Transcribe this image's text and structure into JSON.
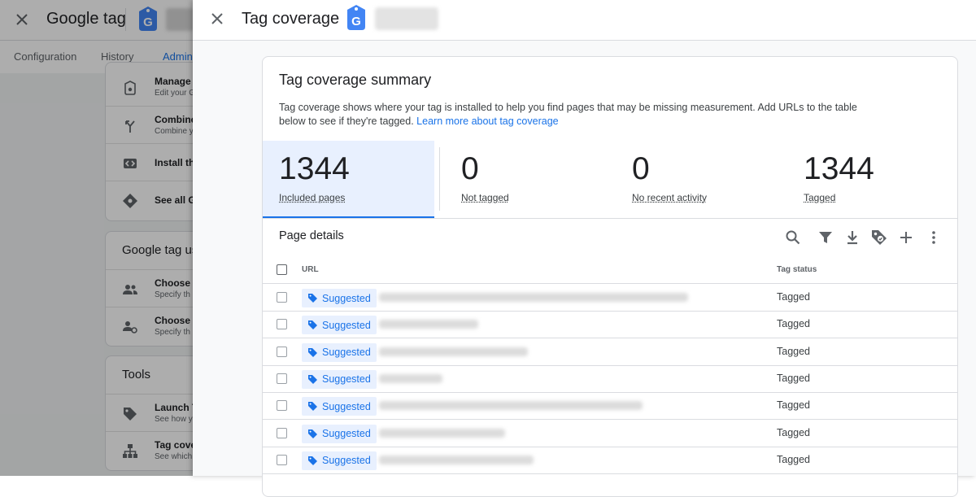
{
  "background": {
    "app_title": "Google tag",
    "tabs": [
      "Configuration",
      "History",
      "Admin"
    ],
    "cards": [
      {
        "title": "",
        "rows": [
          {
            "icon": "tag-settings-icon",
            "line1": "Manage",
            "line2": "Edit your G"
          },
          {
            "icon": "merge-icon",
            "line1": "Combine",
            "line2": "Combine y"
          },
          {
            "icon": "code-icon",
            "line1": "Install th",
            "line2": ""
          },
          {
            "icon": "diamond-icon",
            "line1": "See all G",
            "line2": ""
          }
        ]
      },
      {
        "title": "Google tag use",
        "rows": [
          {
            "icon": "people-icon",
            "line1": "Choose w",
            "line2": "Specify th"
          },
          {
            "icon": "people-settings-icon",
            "line1": "Choose w",
            "line2": "Specify th"
          }
        ]
      },
      {
        "title": "Tools",
        "rows": [
          {
            "icon": "tag-launch-icon",
            "line1": "Launch T",
            "line2": "See how y"
          },
          {
            "icon": "sitemap-icon",
            "line1": "Tag cove",
            "line2": "See which"
          }
        ]
      }
    ]
  },
  "panel": {
    "title": "Tag coverage",
    "summary": {
      "title": "Tag coverage summary",
      "description": "Tag coverage shows where your tag is installed to help you find pages that may be missing measurement. Add URLs to the table below to see if they're tagged.",
      "link": "Learn more about tag coverage"
    },
    "stats": [
      {
        "value": "1344",
        "label": "Included pages"
      },
      {
        "value": "0",
        "label": "Not tagged"
      },
      {
        "value": "0",
        "label": "No recent activity"
      },
      {
        "value": "1344",
        "label": "Tagged"
      }
    ],
    "details": {
      "title": "Page details",
      "toolbar": [
        "search-icon",
        "filter-icon",
        "download-icon",
        "tag-icon",
        "add-icon",
        "more-vert-icon"
      ],
      "columns": {
        "url": "URL",
        "status": "Tag status"
      },
      "rows": [
        {
          "chip": "Suggested",
          "status": "Tagged"
        },
        {
          "chip": "Suggested",
          "status": "Tagged"
        },
        {
          "chip": "Suggested",
          "status": "Tagged"
        },
        {
          "chip": "Suggested",
          "status": "Tagged"
        },
        {
          "chip": "Suggested",
          "status": "Tagged"
        },
        {
          "chip": "Suggested",
          "status": "Tagged"
        },
        {
          "chip": "Suggested",
          "status": "Tagged"
        }
      ]
    }
  },
  "colors": {
    "accent": "#1a73e8",
    "chip_bg": "#e8f0fe",
    "tag_logo": "#4285f4"
  }
}
